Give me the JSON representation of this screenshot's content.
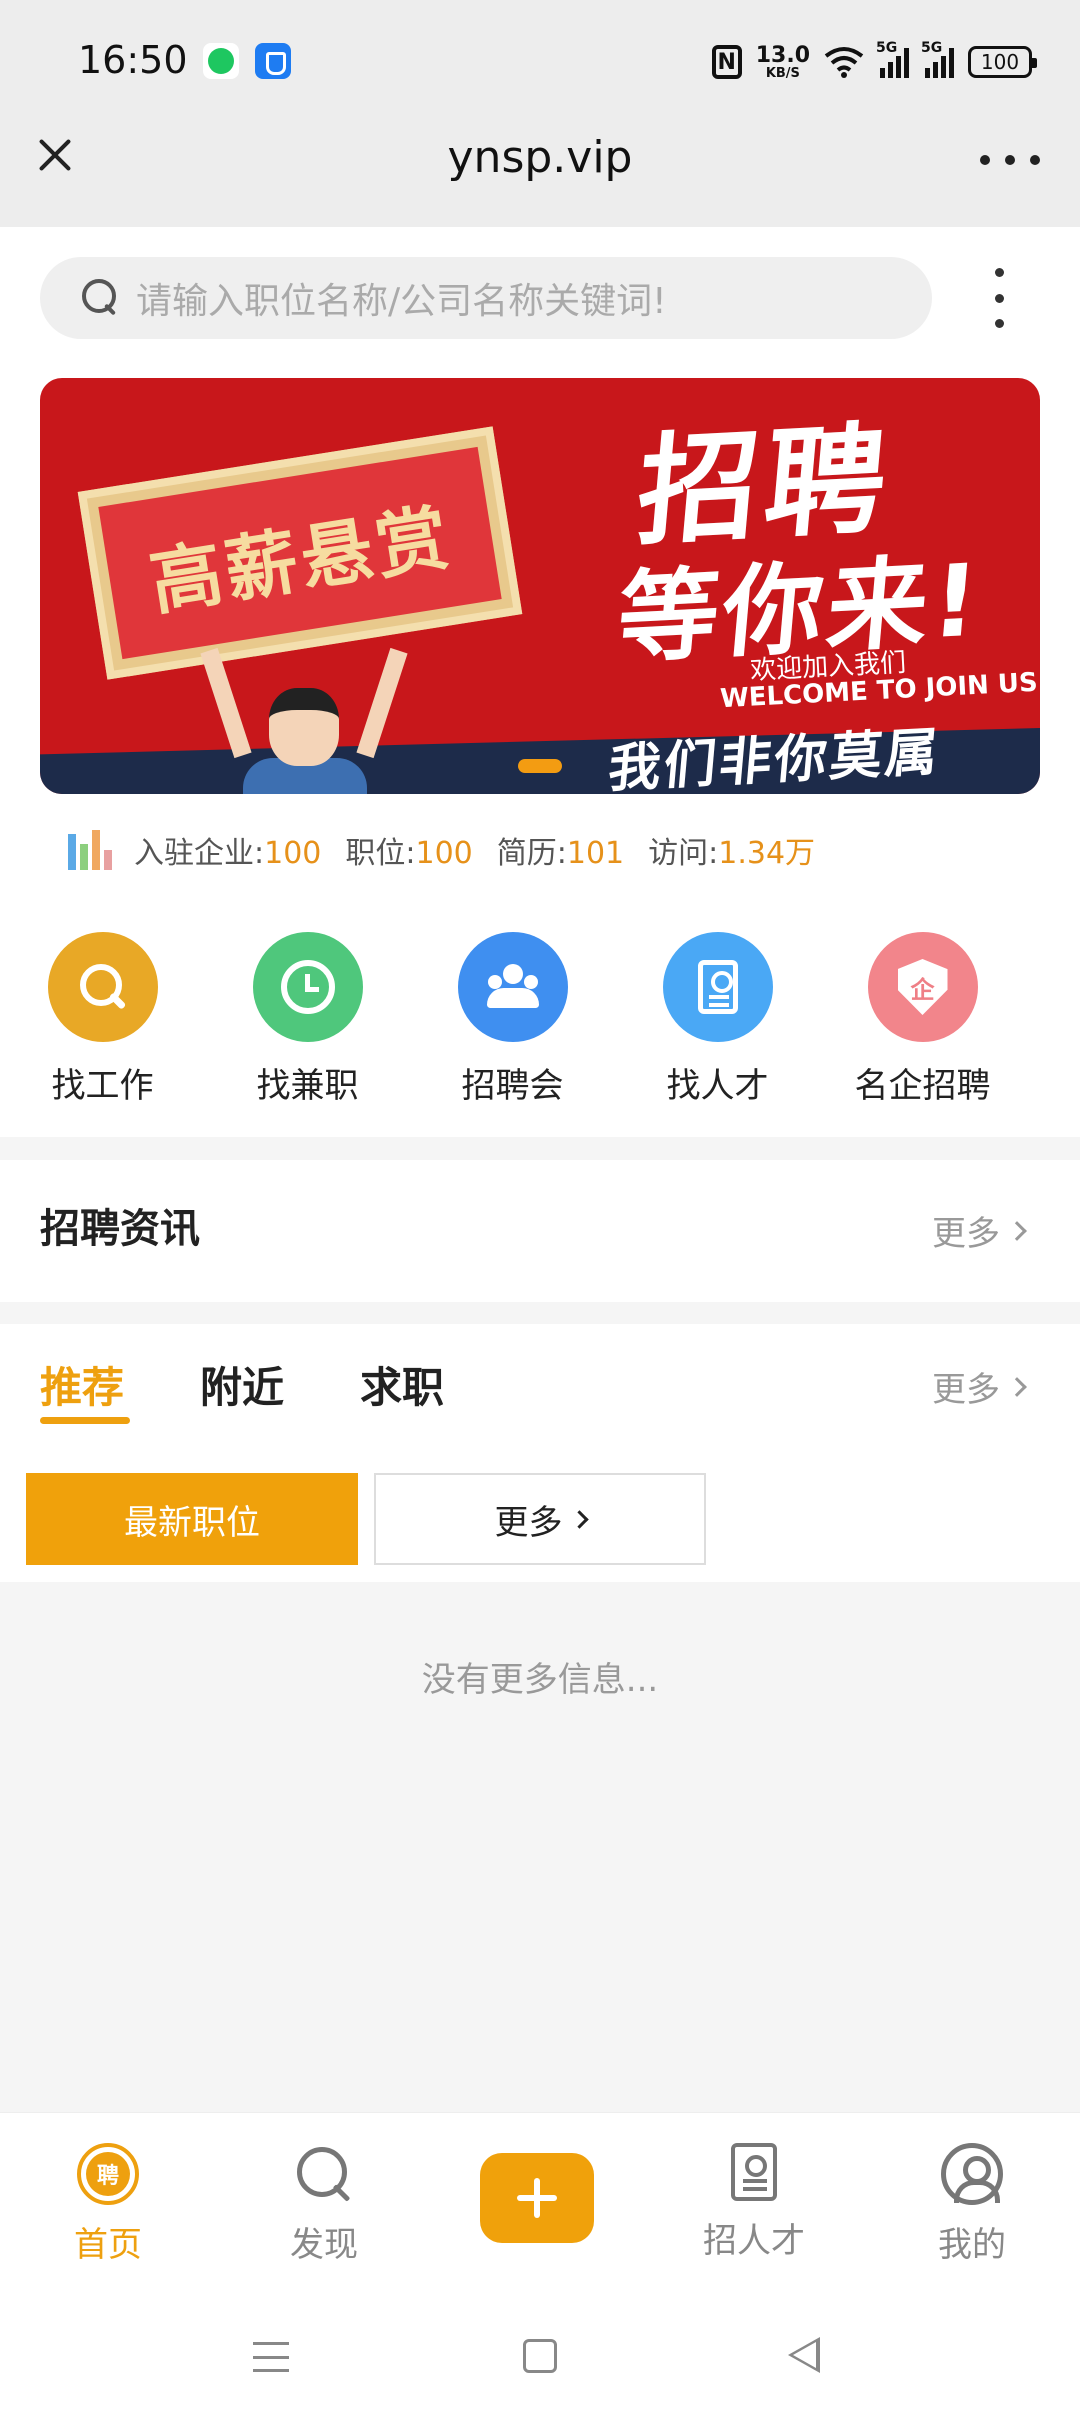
{
  "status_bar": {
    "time": "16:50",
    "nfc": "N",
    "net_speed_value": "13.0",
    "net_speed_unit": "KB/S",
    "sim1": "5G",
    "sim2": "5G",
    "battery": "100"
  },
  "browser": {
    "title": "ynsp.vip"
  },
  "search": {
    "placeholder": "请输入职位名称/公司名称关键词!"
  },
  "banner": {
    "sign_text": "高薪悬赏",
    "headline_1": "招聘",
    "headline_2": "等你来!",
    "welcome_cn": "欢迎加入我们",
    "welcome_en": "WELCOME TO JOIN US",
    "slogan": "我们非你莫属"
  },
  "stats": [
    {
      "label": "入驻企业:",
      "value": "100"
    },
    {
      "label": "职位:",
      "value": "100"
    },
    {
      "label": "简历:",
      "value": "101"
    },
    {
      "label": "访问:",
      "value": "1.34万"
    }
  ],
  "quick_nav": [
    {
      "label": "找工作",
      "icon": "search-icon",
      "color": "#e8a826"
    },
    {
      "label": "找兼职",
      "icon": "clock-icon",
      "color": "#4fc77c"
    },
    {
      "label": "招聘会",
      "icon": "group-icon",
      "color": "#3f8ff0"
    },
    {
      "label": "找人才",
      "icon": "resume-icon",
      "color": "#4aa8f5"
    },
    {
      "label": "名企招聘",
      "icon": "shield-icon",
      "color": "#f2858b",
      "icon_text": "企"
    }
  ],
  "news": {
    "title": "招聘资讯",
    "more": "更多"
  },
  "tabs": {
    "items": [
      "推荐",
      "附近",
      "求职"
    ],
    "more": "更多",
    "newest_button": "最新职位",
    "more_button": "更多"
  },
  "empty_text": "没有更多信息...",
  "bottom_nav": {
    "home": "首页",
    "home_badge": "聘",
    "discover": "发现",
    "talent": "招人才",
    "me": "我的"
  },
  "colors": {
    "accent": "#eea00f",
    "banner_red": "#c8171b"
  }
}
